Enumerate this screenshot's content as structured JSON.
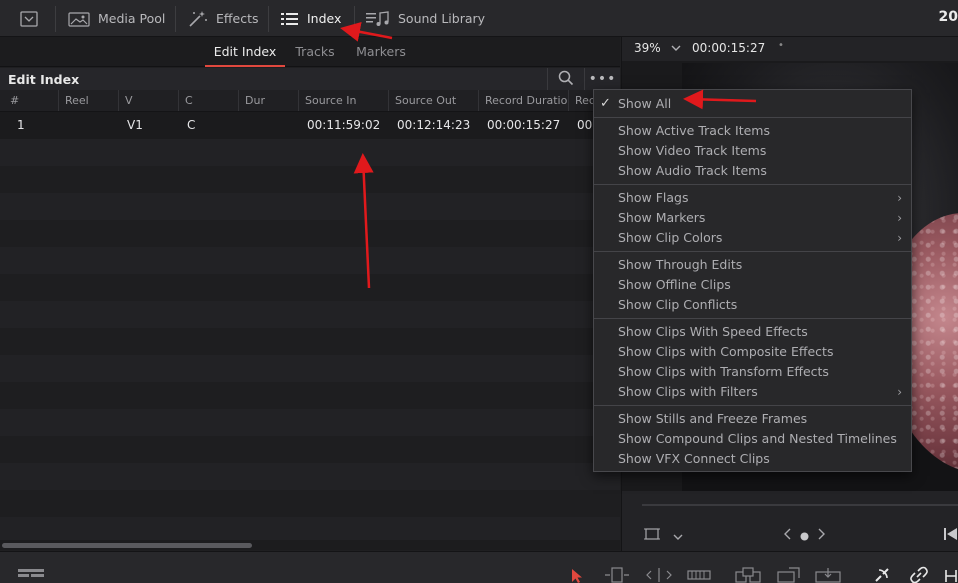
{
  "toolbar": {
    "items": [
      {
        "label": "Media Pool",
        "icon": "media-pool-icon"
      },
      {
        "label": "Effects",
        "icon": "effects-wand-icon"
      },
      {
        "label": "Index",
        "icon": "index-list-icon",
        "active": true
      },
      {
        "label": "Sound Library",
        "icon": "sound-library-icon"
      }
    ],
    "timecode_cut": "20"
  },
  "panel": {
    "tabs": [
      {
        "label": "Edit Index",
        "active": true
      },
      {
        "label": "Tracks"
      },
      {
        "label": "Markers"
      }
    ],
    "title": "Edit Index",
    "more_label": "•••",
    "columns": [
      "#",
      "Reel",
      "V",
      "C",
      "Dur",
      "Source In",
      "Source Out",
      "Record Duratio",
      "Rec"
    ],
    "rows": [
      {
        "num": "1",
        "reel": "",
        "v": "V1",
        "c": "C",
        "dur": "",
        "source_in": "00:11:59:02",
        "source_out": "00:12:14:23",
        "record_duration": "00:00:15:27",
        "rec": "00"
      }
    ]
  },
  "viewer": {
    "zoom": "39%",
    "timecode": "00:00:15:27",
    "dot": "•"
  },
  "menu": {
    "groups": [
      [
        {
          "label": "Show All",
          "checked": true
        }
      ],
      [
        {
          "label": "Show Active Track Items"
        },
        {
          "label": "Show Video Track Items"
        },
        {
          "label": "Show Audio Track Items"
        }
      ],
      [
        {
          "label": "Show Flags",
          "submenu": true
        },
        {
          "label": "Show Markers",
          "submenu": true
        },
        {
          "label": "Show Clip Colors",
          "submenu": true
        }
      ],
      [
        {
          "label": "Show Through Edits"
        },
        {
          "label": "Show Offline Clips"
        },
        {
          "label": "Show Clip Conflicts"
        }
      ],
      [
        {
          "label": "Show Clips With Speed Effects"
        },
        {
          "label": "Show Clips with Composite Effects"
        },
        {
          "label": "Show Clips with Transform Effects"
        },
        {
          "label": "Show Clips with Filters",
          "submenu": true
        }
      ],
      [
        {
          "label": "Show Stills and Freeze Frames"
        },
        {
          "label": "Show Compound Clips and Nested Timelines"
        },
        {
          "label": "Show VFX Connect Clips"
        }
      ]
    ]
  },
  "colors": {
    "accent": "#e1483e",
    "annotation": "#e0191c"
  }
}
